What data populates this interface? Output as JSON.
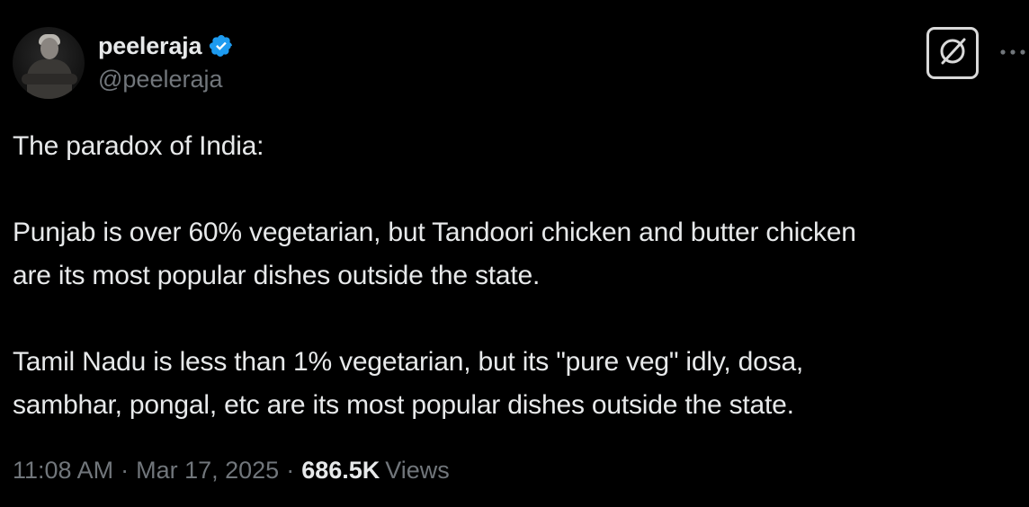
{
  "author": {
    "display_name": "peeleraja",
    "handle": "@peeleraja",
    "verified": true
  },
  "tweet": {
    "lines": {
      "l1": "The paradox of India:",
      "l2": "Punjab is over 60% vegetarian, but Tandoori chicken and butter chicken",
      "l3": "are its most popular dishes outside the state.",
      "l4": "Tamil Nadu is less than 1% vegetarian, but its \"pure veg\" idly, dosa,",
      "l5": "sambhar, pongal, etc are its most popular dishes outside the state."
    }
  },
  "meta": {
    "time": "11:08 AM",
    "separator": "·",
    "date": "Mar 17, 2025",
    "views_count": "686.5K",
    "views_label": "Views"
  },
  "icons": {
    "verified": "verified-badge-icon",
    "grok": "grok-icon",
    "more": "more-options-icon"
  },
  "colors": {
    "background": "#000000",
    "text_primary": "#e7e9ea",
    "text_secondary": "#71767b",
    "verified_blue": "#1d9bf0"
  }
}
